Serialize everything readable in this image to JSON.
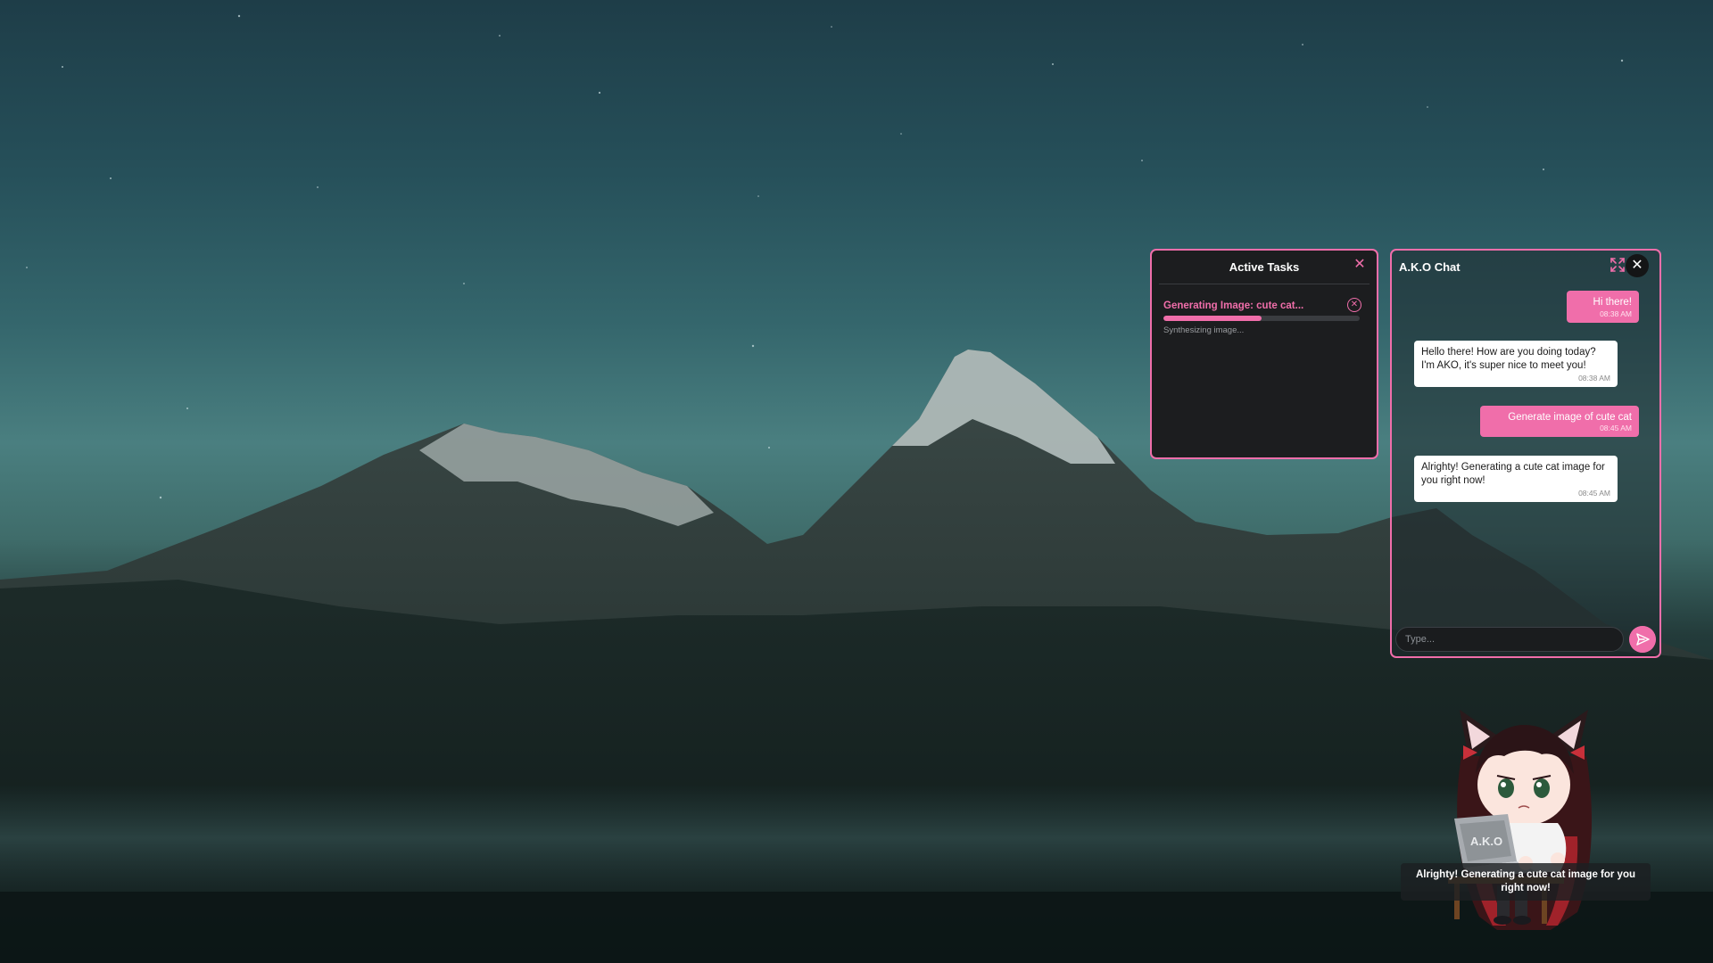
{
  "tasks_panel": {
    "title": "Active Tasks",
    "close_glyph": "✕",
    "task": {
      "title": "Generating Image: cute cat...",
      "progress": 0.5,
      "status": "Synthesizing image...",
      "cancel_glyph": "✕"
    }
  },
  "chat_panel": {
    "title": "A.K.O Chat",
    "close_glyph": "✕",
    "messages": [
      {
        "role": "user",
        "text": "Hi there!",
        "time": "08:38 AM"
      },
      {
        "role": "bot",
        "text": "Hello there! How are you doing today? I'm AKO, it's super nice to meet you!",
        "time": "08:38 AM"
      },
      {
        "role": "user",
        "text": "Generate image of cute cat",
        "time": "08:45 AM"
      },
      {
        "role": "bot",
        "text": "Alrighty! Generating a cute cat image for you right now!",
        "time": "08:45 AM"
      }
    ],
    "input": {
      "placeholder": "Type...",
      "value": ""
    }
  },
  "mascot": {
    "laptop_label": "A.K.O",
    "speech": "Alrighty! Generating a cute cat image for you right now!"
  },
  "icons": {
    "expand": "expand-icon",
    "send": "send-icon",
    "close": "close-icon",
    "cancel": "cancel-circle-icon"
  },
  "colors": {
    "accent": "#f06eaa",
    "panel_bg": "#1c1d1f",
    "bot_bubble": "#ffffff",
    "user_bubble": "#f06eaa"
  }
}
